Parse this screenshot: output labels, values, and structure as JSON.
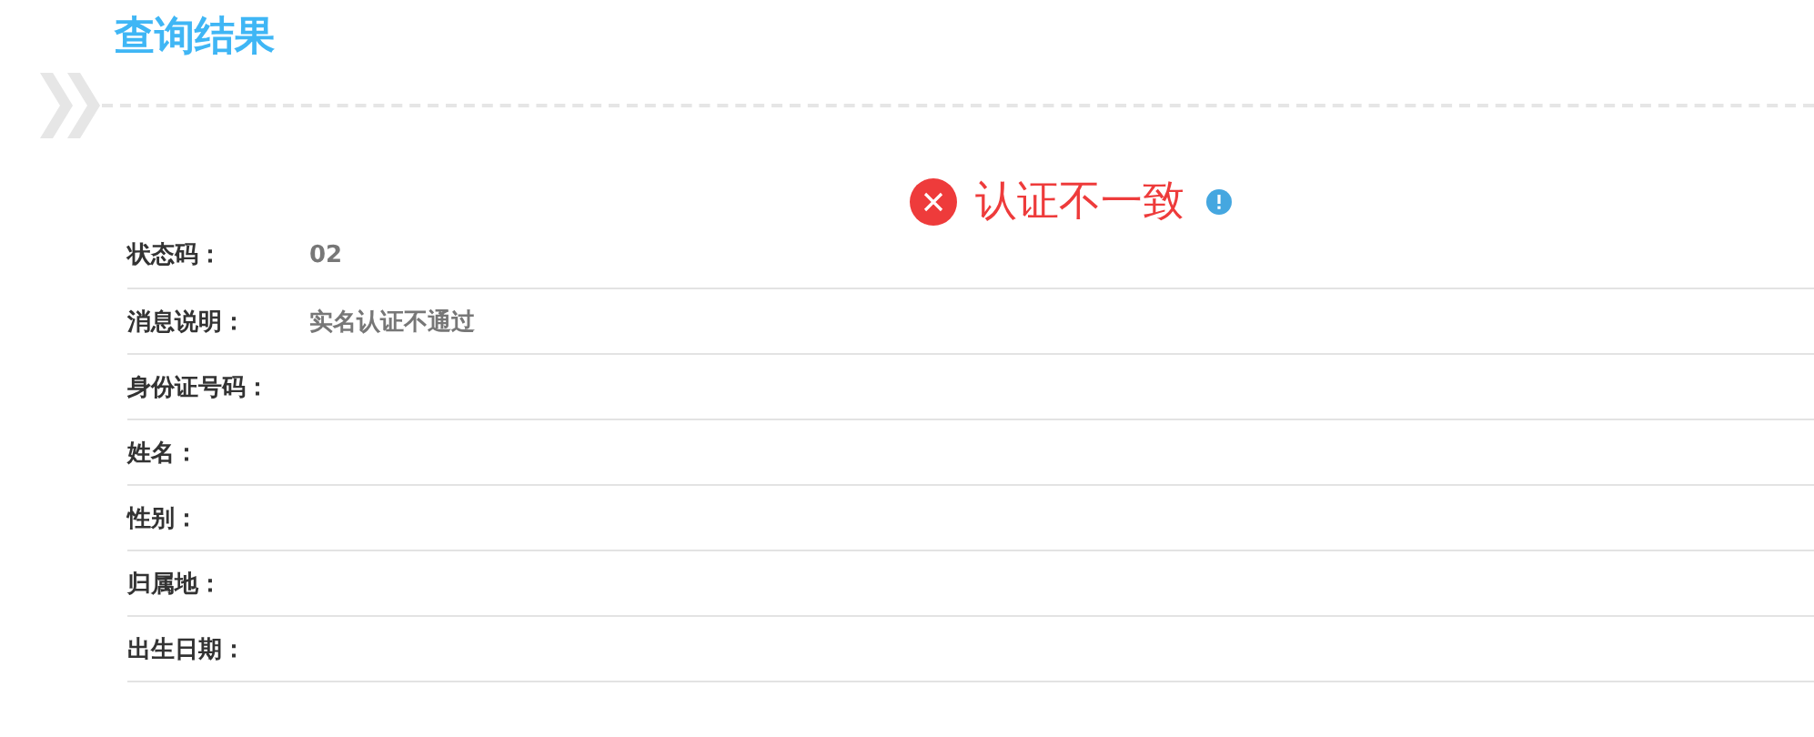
{
  "section_title": "查询结果",
  "result": {
    "kind": "fail",
    "text": "认证不一致"
  },
  "fields": [
    {
      "label": "状态码：",
      "value": "02"
    },
    {
      "label": "消息说明：",
      "value": "实名认证不通过"
    },
    {
      "label": "身份证号码："
    },
    {
      "label": "姓名："
    },
    {
      "label": "性别："
    },
    {
      "label": "归属地："
    },
    {
      "label": "出生日期："
    }
  ]
}
